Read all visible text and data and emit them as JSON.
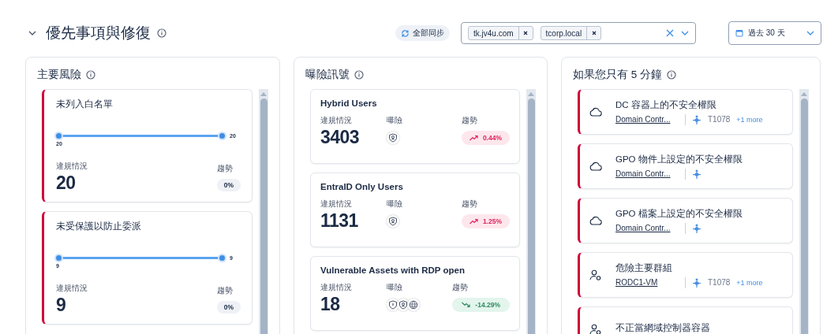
{
  "header": {
    "title": "優先事項與修復",
    "sync_label": "全部同步",
    "domains": [
      {
        "label": "tk.jv4u.com"
      },
      {
        "label": "tcorp.local"
      }
    ],
    "date_range": "過去 30 天"
  },
  "top_risks": {
    "title": "主要風險",
    "cards": [
      {
        "kind": "flat",
        "title": "未列入白名單",
        "range_min": "20",
        "range_max": "20",
        "violations_label": "違規情況",
        "violations": "20",
        "trend_label": "趨勢",
        "trend": "0%"
      },
      {
        "kind": "flat",
        "title": "未受保護以防止委派",
        "range_min": "9",
        "range_max": "9",
        "violations_label": "違規情況",
        "violations": "9",
        "trend_label": "趨勢",
        "trend": "0%"
      }
    ]
  },
  "exposure_signals": {
    "title": "曝險訊號",
    "cards": [
      {
        "kind": "up",
        "title": "Hybrid Users",
        "violations_label": "違規情況",
        "violations": "3403",
        "exposure_label": "曝險",
        "exposure_icons": [
          {
            "kind": "shield-person"
          }
        ],
        "trend_label": "趨勢",
        "trend": "0.44%"
      },
      {
        "kind": "up",
        "title": "EntraID Only Users",
        "violations_label": "違規情況",
        "violations": "1131",
        "exposure_label": "曝險",
        "exposure_icons": [
          {
            "kind": "shield-person"
          }
        ],
        "trend_label": "趨勢",
        "trend": "1.25%"
      },
      {
        "kind": "down",
        "title": "Vulnerable Assets with RDP open",
        "violations_label": "違規情況",
        "violations": "18",
        "exposure_label": "曝險",
        "exposure_icons": [
          {
            "kind": "shield"
          },
          {
            "kind": "shield-person"
          },
          {
            "kind": "globe"
          }
        ],
        "trend_label": "趨勢",
        "trend": "-14.29%"
      }
    ]
  },
  "five_minutes": {
    "title": "如果您只有 5 分鐘",
    "items": [
      {
        "kind": "cloud",
        "title": "DC 容器上的不安全權限",
        "link": "Domain Contr...",
        "technique": "T1078",
        "more": "+1 more"
      },
      {
        "kind": "cloud",
        "title": "GPO 物件上設定的不安全權限",
        "link": "Domain Contr..."
      },
      {
        "kind": "cloud",
        "title": "GPO 檔案上設定的不安全權限",
        "link": "Domain Contr..."
      },
      {
        "kind": "user",
        "title": "危險主要群組",
        "link": "RODC1-VM",
        "technique": "T1078",
        "more": "+1 more"
      },
      {
        "kind": "user",
        "title": "不正當網域控制器容器"
      }
    ]
  }
}
